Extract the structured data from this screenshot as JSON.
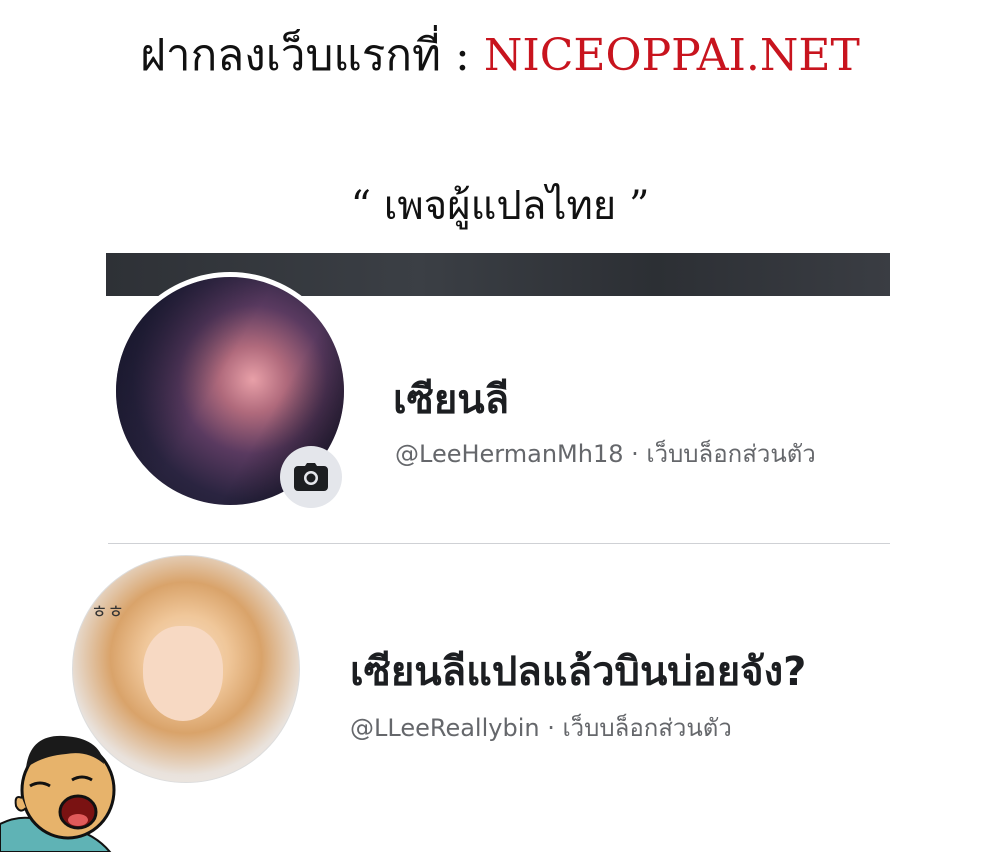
{
  "header": {
    "prefix": "ฝากลงเว็บแรกที่ : ",
    "site": "NICEOPPAI.NET"
  },
  "caption": "“ เพจผู้แปลไทย ”",
  "profiles": [
    {
      "name": "เซียนลี",
      "handle": "@LeeHermanMh18",
      "separator": " · ",
      "category": "เว็บบล็อกส่วนตัว"
    },
    {
      "name": "เซียนลีแปลแล้วบินบ่อยจัง?",
      "handle": "@LLeeReallybin",
      "separator": " · ",
      "category": "เว็บบล็อกส่วนตัว",
      "avatar_sfx": "ㅎㅎ"
    }
  ],
  "icons": {
    "camera": "camera-icon"
  },
  "colors": {
    "site_red": "#c8141e",
    "subtext_gray": "#65676b",
    "camera_bg": "#e4e6eb"
  }
}
